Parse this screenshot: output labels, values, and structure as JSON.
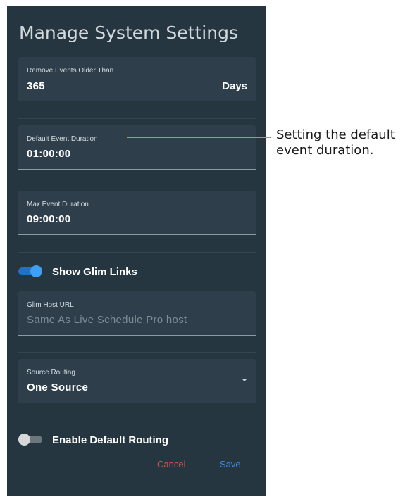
{
  "dialog": {
    "title": "Manage System Settings",
    "remove_events": {
      "label": "Remove Events Older Than",
      "value": "365",
      "suffix": "Days"
    },
    "default_duration": {
      "label": "Default Event Duration",
      "value": "01:00:00"
    },
    "max_duration": {
      "label": "Max Event Duration",
      "value": "09:00:00"
    },
    "show_glim_links": {
      "label": "Show Glim Links",
      "on": true
    },
    "glim_host_url": {
      "label": "Glim Host URL",
      "placeholder": "Same As Live Schedule Pro host"
    },
    "source_routing": {
      "label": "Source Routing",
      "value": "One Source"
    },
    "enable_default_routing": {
      "label": "Enable Default Routing",
      "on": false
    },
    "cancel_label": "Cancel",
    "save_label": "Save"
  },
  "annotation": {
    "text_line1": "Setting the default",
    "text_line2": "event duration."
  },
  "colors": {
    "panel": "#263640",
    "field": "#2e3f4b",
    "toggle_on": "#3ea0f5",
    "cancel": "#d9534f",
    "save": "#3a8ee6",
    "callout_line": "#e8823a"
  }
}
